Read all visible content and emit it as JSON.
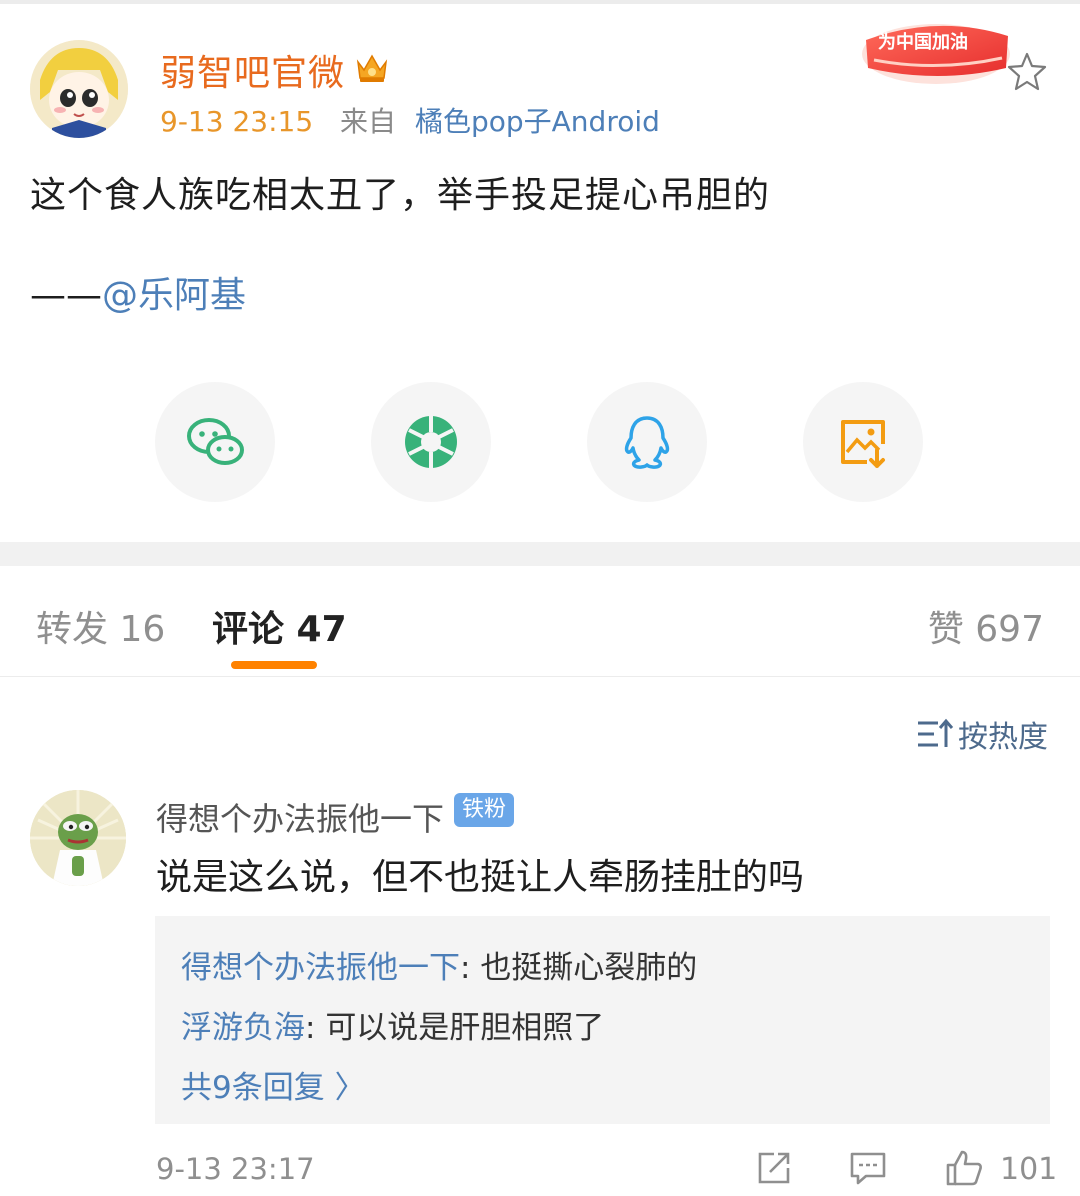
{
  "post": {
    "author": "弱智吧官微",
    "time": "9-13 23:15",
    "from_label": "来自",
    "source": "橘色pop子Android",
    "text": "这个食人族吃相太丑了，举手投足提心吊胆的",
    "credit_dash": "——",
    "credit_mention": "@乐阿基",
    "cheer_badge": "为中国加油"
  },
  "share": [
    "wechat-icon",
    "moments-icon",
    "qq-icon",
    "save-image-icon"
  ],
  "tabs": {
    "repost": "转发 16",
    "comment": "评论 47",
    "like": "赞 697"
  },
  "sort": {
    "label": "按热度"
  },
  "comment": {
    "user": "得想个办法振他一下",
    "badge": "铁粉",
    "text": "说是这么说，但不也挺让人牵肠挂肚的吗",
    "replies": [
      {
        "user": "得想个办法振他一下",
        "sep": ": ",
        "text": "也挺撕心裂肺的"
      },
      {
        "user": "浮游负海",
        "sep": ": ",
        "text": "可以说是肝胆相照了"
      }
    ],
    "more_replies": "共9条回复 〉",
    "time": "9-13 23:17",
    "like_count": "101"
  },
  "colors": {
    "accent": "#ff8200",
    "link": "#4d7fb8",
    "author": "#e86a1e"
  }
}
